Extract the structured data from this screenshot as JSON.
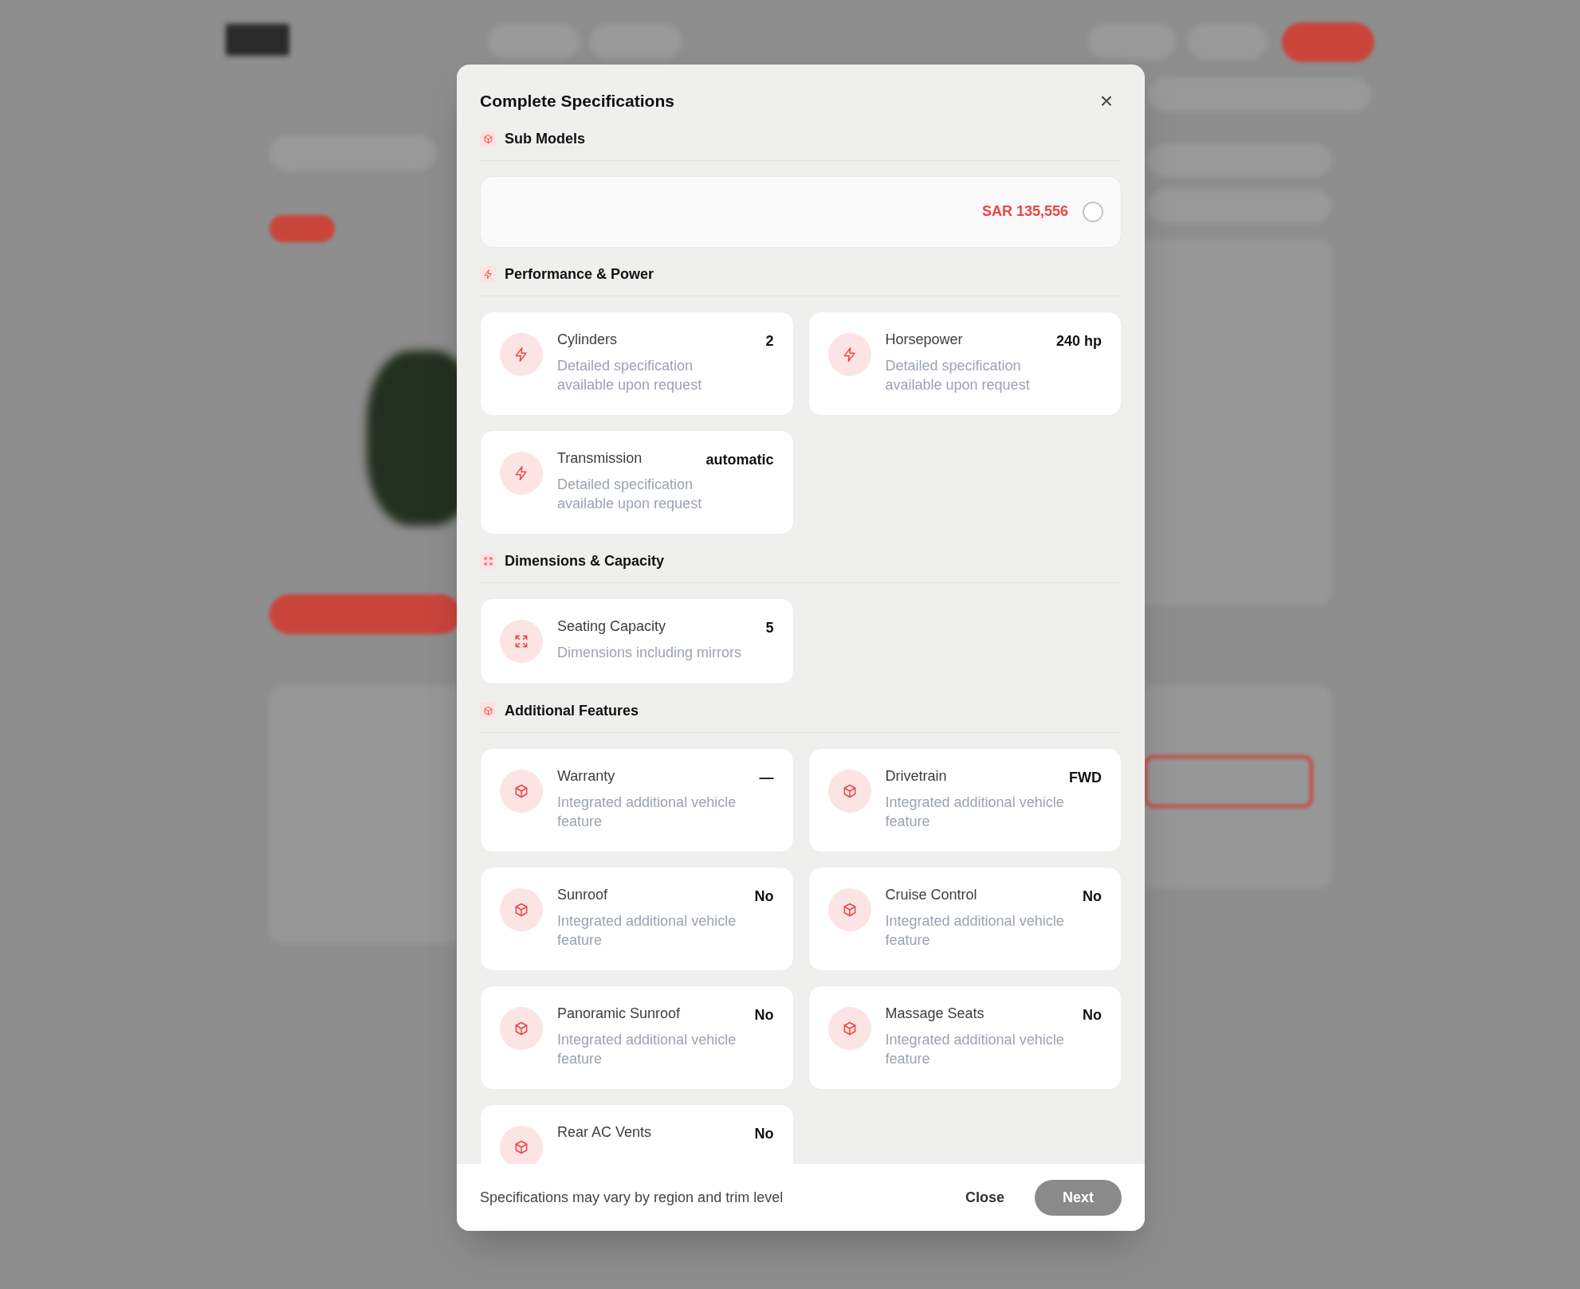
{
  "dialog": {
    "title": "Complete Specifications",
    "close_icon": "×",
    "sections": [
      {
        "kind": "submodels",
        "title": "Sub Models",
        "submodels": [
          {
            "price": "SAR 135,556",
            "selected": false
          }
        ]
      },
      {
        "kind": "specs",
        "title": "Performance & Power",
        "items": [
          {
            "label": "Cylinders",
            "value": "2",
            "description": "Detailed specification available upon request"
          },
          {
            "label": "Horsepower",
            "value": "240 hp",
            "description": "Detailed specification available upon request"
          },
          {
            "label": "Transmission",
            "value": "automatic",
            "description": "Detailed specification available upon request"
          }
        ]
      },
      {
        "kind": "specs",
        "title": "Dimensions & Capacity",
        "items": [
          {
            "label": "Seating Capacity",
            "value": "5",
            "description": "Dimensions including mirrors"
          }
        ]
      },
      {
        "kind": "specs",
        "title": "Additional Features",
        "items": [
          {
            "label": "Warranty",
            "value": "—",
            "description": "Integrated additional vehicle feature"
          },
          {
            "label": "Drivetrain",
            "value": "FWD",
            "description": "Integrated additional vehicle feature"
          },
          {
            "label": "Sunroof",
            "value": "No",
            "description": "Integrated additional vehicle feature"
          },
          {
            "label": "Cruise Control",
            "value": "No",
            "description": "Integrated additional vehicle feature"
          },
          {
            "label": "Panoramic Sunroof",
            "value": "No",
            "description": "Integrated additional vehicle feature"
          },
          {
            "label": "Massage Seats",
            "value": "No",
            "description": "Integrated additional vehicle feature"
          },
          {
            "label": "Rear AC Vents",
            "value": "No"
          }
        ]
      }
    ],
    "footer_note": "Specifications may vary by region and trim level",
    "buttons": [
      {
        "kind": "secondary",
        "label": "Close"
      },
      {
        "kind": "primary",
        "label": "Next"
      }
    ]
  }
}
